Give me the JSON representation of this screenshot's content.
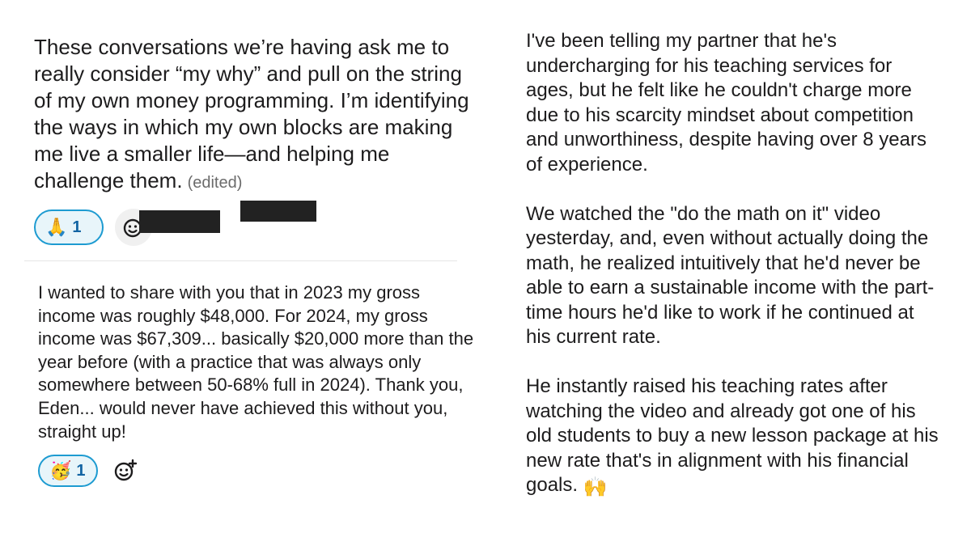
{
  "message_1": {
    "text": "These conversations we’re having ask me to really consider “my why” and pull on the string of my own money programming. I’m identifying the ways in which my own blocks are making me live a smaller life—and helping me challenge them.",
    "edited_label": "(edited)",
    "reaction": {
      "emoji": "🙏",
      "count": "1"
    },
    "add_reaction_icon": "add-reaction-icon"
  },
  "message_2": {
    "text": "I wanted to share with you that in 2023 my gross income was roughly $48,000.  For 2024, my gross income was $67,309... basically $20,000 more than the year before (with a practice that was always only somewhere between 50-68% full in 2024). Thank you, Eden... would never have achieved this without you, straight up!",
    "reaction": {
      "emoji": "🥳",
      "count": "1"
    },
    "add_reaction_icon": "add-reaction-icon"
  },
  "message_3": {
    "paragraphs": [
      "I've been telling my partner that he's undercharging for his teaching services for ages, but he felt like he couldn't charge more due to his scarcity mindset about competition and unworthiness, despite having over 8 years of experience.",
      "We watched the \"do the math on it\" video yesterday, and, even without actually doing the math, he realized intuitively that he'd never be able to earn a sustainable income with the part-time hours he'd like to work if he continued at his current rate.",
      "He instantly raised his teaching rates after watching the video and already got one of his old students to buy a new lesson package at his new rate that's in alignment with his financial goals."
    ],
    "trailing_emoji": "🙌"
  },
  "colors": {
    "reaction_border": "#1d9bd1",
    "reaction_bg": "#e8f5fa",
    "reaction_count": "#1264a3",
    "redaction": "#222222"
  }
}
